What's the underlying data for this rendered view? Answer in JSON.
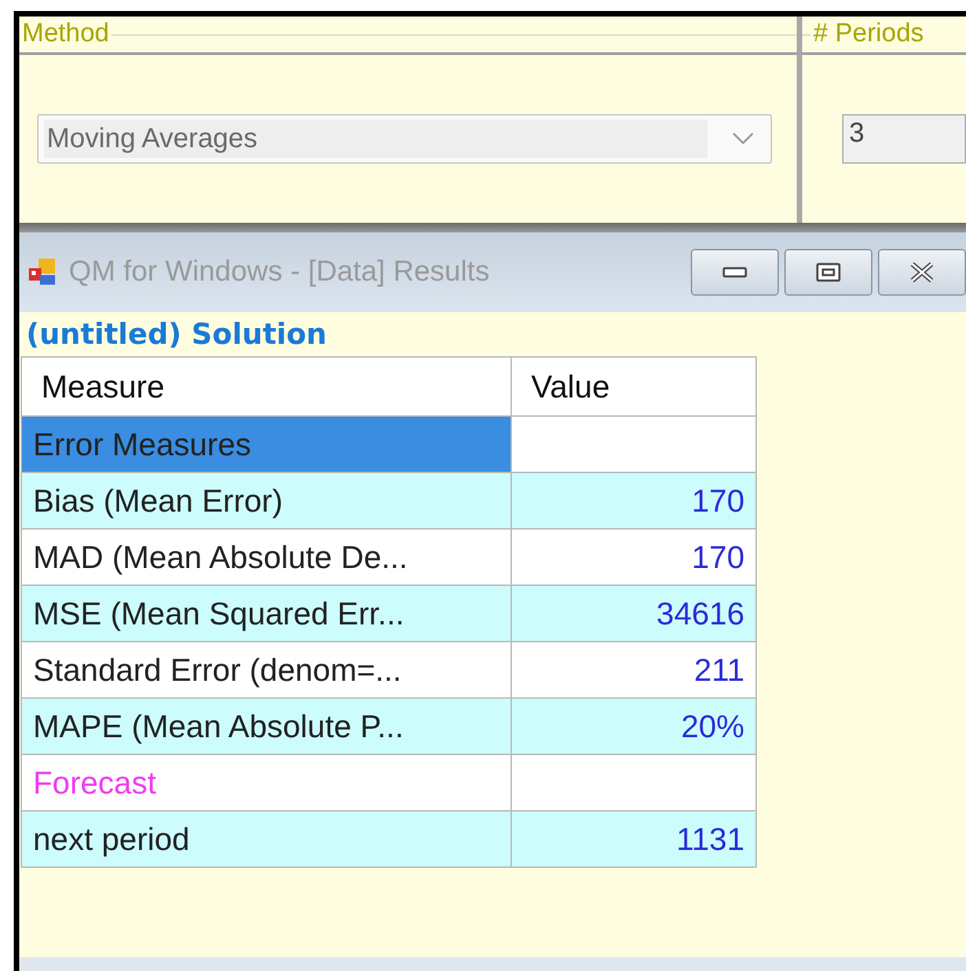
{
  "method_panel": {
    "method": {
      "label": "Method",
      "value": "Moving Averages",
      "disabled": true
    },
    "periods": {
      "label": "# Periods",
      "value": "3"
    }
  },
  "results_window": {
    "title": "QM for Windows - [Data] Results",
    "active": false,
    "heading": "(untitled) Solution",
    "table": {
      "columns": [
        "Measure",
        "Value"
      ],
      "rows": [
        {
          "kind": "section",
          "measure": "Error Measures",
          "value": "",
          "selected": true,
          "shaded": false
        },
        {
          "kind": "data",
          "measure": "Bias (Mean Error)",
          "value": "170",
          "selected": false,
          "shaded": true
        },
        {
          "kind": "data",
          "measure": "MAD (Mean Absolute De...",
          "value": "170",
          "selected": false,
          "shaded": false
        },
        {
          "kind": "data",
          "measure": "MSE (Mean Squared Err...",
          "value": "34616",
          "selected": false,
          "shaded": true
        },
        {
          "kind": "data",
          "measure": "Standard Error (denom=...",
          "value": "211",
          "selected": false,
          "shaded": false
        },
        {
          "kind": "data",
          "measure": "MAPE (Mean Absolute P...",
          "value": "20%",
          "selected": false,
          "shaded": true
        },
        {
          "kind": "forecast",
          "measure": "Forecast",
          "value": "",
          "selected": false,
          "shaded": false
        },
        {
          "kind": "data",
          "measure": "next period",
          "value": "1131",
          "selected": false,
          "shaded": true
        }
      ]
    }
  }
}
